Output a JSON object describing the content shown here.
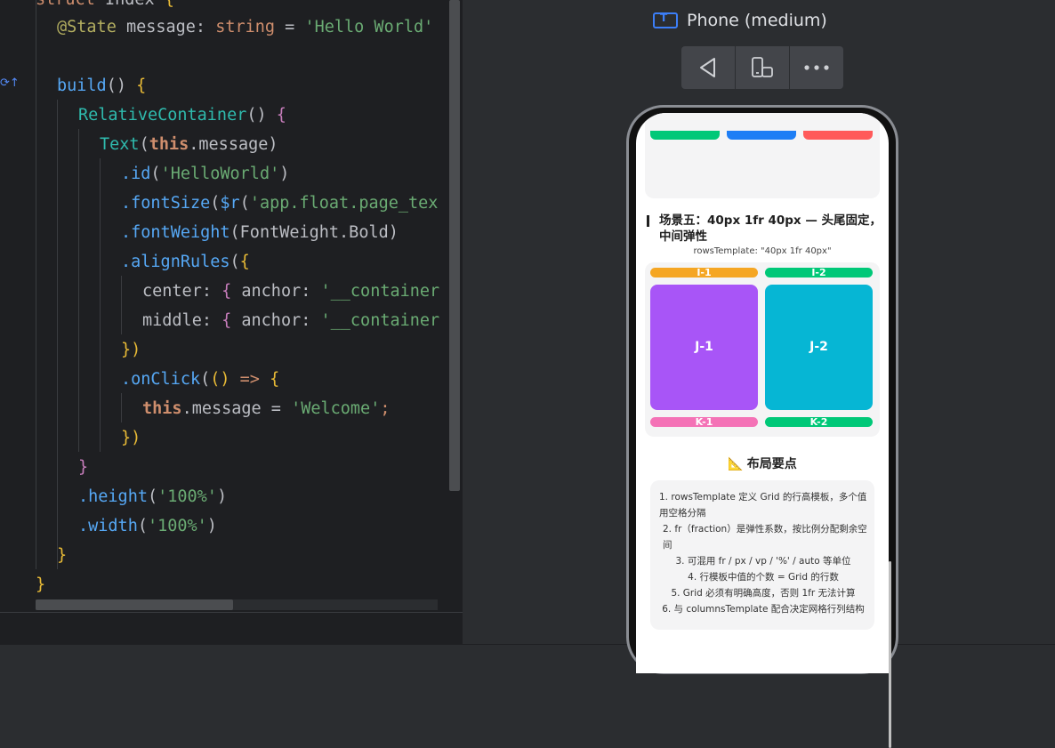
{
  "editor": {
    "lines": [
      {
        "id": "l0",
        "tokens": [
          [
            "struct",
            "kw"
          ],
          [
            " Index ",
            "pn"
          ],
          [
            "{",
            "gold"
          ]
        ]
      },
      {
        "id": "l1",
        "tokens": [
          [
            "@State",
            "ann"
          ],
          [
            " message: ",
            "pn"
          ],
          [
            "string",
            "kw"
          ],
          [
            " = ",
            "pn"
          ],
          [
            "'Hello World'",
            "str"
          ]
        ]
      },
      {
        "id": "l2",
        "tokens": []
      },
      {
        "id": "l3",
        "tokens": [
          [
            "build",
            "fn"
          ],
          [
            "() ",
            "pn"
          ],
          [
            "{",
            "gold"
          ]
        ]
      },
      {
        "id": "l4",
        "tokens": [
          [
            "RelativeContainer",
            "ty"
          ],
          [
            "() ",
            "pn"
          ],
          [
            "{",
            "purple"
          ]
        ]
      },
      {
        "id": "l5",
        "tokens": [
          [
            "Text",
            "ty"
          ],
          [
            "(",
            "pn"
          ],
          [
            "this",
            "this"
          ],
          [
            ".message)",
            "pn"
          ]
        ]
      },
      {
        "id": "l6",
        "tokens": [
          [
            ".id",
            "fn"
          ],
          [
            "(",
            "pn"
          ],
          [
            "'HelloWorld'",
            "str"
          ],
          [
            ")",
            "pn"
          ]
        ]
      },
      {
        "id": "l7",
        "tokens": [
          [
            ".fontSize",
            "fn"
          ],
          [
            "(",
            "pn"
          ],
          [
            "$r",
            "fn"
          ],
          [
            "(",
            "pn"
          ],
          [
            "'app.float.page_tex",
            "str"
          ]
        ]
      },
      {
        "id": "l8",
        "tokens": [
          [
            ".fontWeight",
            "fn"
          ],
          [
            "(FontWeight.Bold)",
            "pn"
          ]
        ]
      },
      {
        "id": "l9",
        "tokens": [
          [
            ".alignRules",
            "fn"
          ],
          [
            "(",
            "pn"
          ],
          [
            "{",
            "gold"
          ]
        ]
      },
      {
        "id": "l10",
        "tokens": [
          [
            "center: ",
            "pn"
          ],
          [
            "{",
            "purple"
          ],
          [
            " anchor: ",
            "pn"
          ],
          [
            "'__container",
            "str"
          ]
        ]
      },
      {
        "id": "l11",
        "tokens": [
          [
            "middle: ",
            "pn"
          ],
          [
            "{",
            "purple"
          ],
          [
            " anchor: ",
            "pn"
          ],
          [
            "'__container",
            "str"
          ]
        ]
      },
      {
        "id": "l12",
        "tokens": [
          [
            "})",
            "gold"
          ]
        ]
      },
      {
        "id": "l13",
        "tokens": [
          [
            ".onClick",
            "fn"
          ],
          [
            "(",
            "pn"
          ],
          [
            "()",
            "gold"
          ],
          [
            " => ",
            "kw"
          ],
          [
            "{",
            "gold"
          ]
        ]
      },
      {
        "id": "l14",
        "tokens": [
          [
            "this",
            "this"
          ],
          [
            ".message = ",
            "pn"
          ],
          [
            "'Welcome'",
            "str"
          ],
          [
            ";",
            "kw"
          ]
        ]
      },
      {
        "id": "l15",
        "tokens": [
          [
            "})",
            "gold"
          ]
        ]
      },
      {
        "id": "l16",
        "tokens": [
          [
            "}",
            "purple"
          ]
        ]
      },
      {
        "id": "l17",
        "tokens": [
          [
            ".height",
            "fn"
          ],
          [
            "(",
            "pn"
          ],
          [
            "'100%'",
            "str"
          ],
          [
            ")",
            "pn"
          ]
        ]
      },
      {
        "id": "l18",
        "tokens": [
          [
            ".width",
            "fn"
          ],
          [
            "(",
            "pn"
          ],
          [
            "'100%'",
            "str"
          ],
          [
            ")",
            "pn"
          ]
        ]
      },
      {
        "id": "l19",
        "tokens": [
          [
            "}",
            "gold"
          ]
        ]
      },
      {
        "id": "l20",
        "tokens": [
          [
            "}",
            "gold"
          ]
        ]
      }
    ],
    "colors": {
      "kw": "#cf8e6d",
      "ann": "#b3ae60",
      "str": "#6aab73",
      "fn": "#56a8f5",
      "ty": "#2fbaad",
      "bg": "#1e1f22"
    }
  },
  "preview": {
    "device_name": "Phone (medium)",
    "toolbar": {
      "back_icon": "triangle-back-icon",
      "rotate_icon": "rotate-device-icon",
      "more_icon": "more-dots-icon"
    },
    "phone": {
      "top_colors": [
        "#00c878",
        "#1e7ef5",
        "#ff5a5a"
      ],
      "section5": {
        "title": "场景五：40px 1fr 40px — 头尾固定，中间弹性",
        "subtitle": "rowsTemplate: \"40px 1fr 40px\"",
        "header_cells": [
          {
            "label": "I-1",
            "color": "#f5a623"
          },
          {
            "label": "I-2",
            "color": "#00c878"
          }
        ],
        "middle_cells": [
          {
            "label": "J-1",
            "color": "#a855f7"
          },
          {
            "label": "J-2",
            "color": "#06b6d4"
          }
        ],
        "footer_cells": [
          {
            "label": "K-1",
            "color": "#f472b6"
          },
          {
            "label": "K-2",
            "color": "#00c878"
          }
        ]
      },
      "tips_heading": "布局要点",
      "tips_icon": "triangular-ruler-icon",
      "tips": [
        "1. rowsTemplate 定义 Grid 的行高模板，多个值用空格分隔",
        "2. fr（fraction）是弹性系数，按比例分配剩余空间",
        "3. 可混用 fr / px / vp / '%' / auto 等单位",
        "4. 行模板中值的个数 = Grid 的行数",
        "5. Grid 必须有明确高度，否则 1fr 无法计算",
        "6. 与 columnsTemplate 配合决定网格行列结构"
      ]
    }
  }
}
